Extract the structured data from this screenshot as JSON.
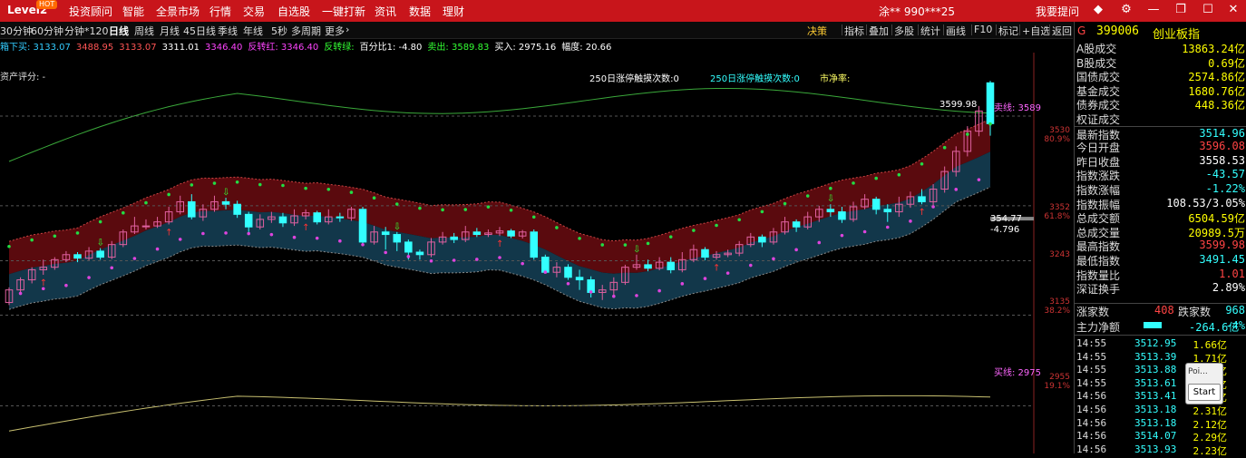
{
  "topbar": {
    "brand": "Level2",
    "hot_badge": "HOT",
    "menu": [
      "投资顾问",
      "智能",
      "全景市场",
      "行情",
      "交易",
      "自选股",
      "一键打新",
      "资讯",
      "数据",
      "理财"
    ],
    "user": "涂**  990***25",
    "help": "我要提问"
  },
  "periods": [
    "30分钟",
    "60分钟",
    "分钟*120",
    "日线",
    "周线",
    "月线",
    "45日线",
    "季线",
    "年线",
    "5秒",
    "多周期",
    "更多"
  ],
  "active_period": "日线",
  "tools": [
    "决策",
    "指标",
    "叠加",
    "多股",
    "统计",
    "画线",
    "F10",
    "标记",
    "+自选",
    "返回"
  ],
  "legend": [
    {
      "text": "箱下买: 3133.07",
      "color": "#33ccff"
    },
    {
      "text": "3488.95",
      "color": "#ff5555"
    },
    {
      "text": "3133.07",
      "color": "#ff5555"
    },
    {
      "text": "3311.01",
      "color": "#ffffff"
    },
    {
      "text": "3346.40",
      "color": "#ff44ff"
    },
    {
      "text": "反转红: 3346.40",
      "color": "#ff44ff"
    },
    {
      "text": "反转绿:",
      "color": "#33ff33"
    },
    {
      "text": "百分比1: -4.80",
      "color": "#ffffff"
    },
    {
      "text": "卖出: 3589.83",
      "color": "#33ff33"
    },
    {
      "text": "买入: 2975.16",
      "color": "#ffffff"
    },
    {
      "text": "幅度: 20.66",
      "color": "#ffffff"
    }
  ],
  "chart_labels": {
    "asset_score": "资产评分: -",
    "limit_up_touch": "250日涨停触摸次数:0",
    "limit_down_touch": "250日涨停触摸次数:0",
    "pb": "市净率:",
    "sell_line": "卖线: 3589",
    "buy_line": "买线: 2975",
    "high_mark": "3599.98",
    "cur_value": "354.77",
    "cur_change": "-4.796"
  },
  "price_axis": [
    {
      "price": "3530",
      "pct": "80.9%"
    },
    {
      "price": "3352",
      "pct": "61.8%"
    },
    {
      "price": "3243",
      "pct": ""
    },
    {
      "price": "3135",
      "pct": "38.2%"
    },
    {
      "price": "2955",
      "pct": "19.1%"
    }
  ],
  "quote_panel": {
    "code_prefix": "G",
    "code": "399006",
    "name": "创业板指",
    "rows": [
      {
        "label": "A股成交",
        "value": "13863.24亿",
        "color": "#ffff00"
      },
      {
        "label": "B股成交",
        "value": "0.69亿",
        "color": "#ffff00"
      },
      {
        "label": "国债成交",
        "value": "2574.86亿",
        "color": "#ffff00"
      },
      {
        "label": "基金成交",
        "value": "1680.76亿",
        "color": "#ffff00"
      },
      {
        "label": "债券成交",
        "value": "448.36亿",
        "color": "#ffff00"
      },
      {
        "label": "权证成交",
        "value": "",
        "color": "#ffff00"
      },
      {
        "label": "最新指数",
        "value": "3514.96",
        "color": "#33ffff"
      },
      {
        "label": "今日开盘",
        "value": "3596.08",
        "color": "#ff4444"
      },
      {
        "label": "昨日收盘",
        "value": "3558.53",
        "color": "#ffffff"
      },
      {
        "label": "指数涨跌",
        "value": "-43.57",
        "color": "#33ffff"
      },
      {
        "label": "指数涨幅",
        "value": "-1.22%",
        "color": "#33ffff"
      },
      {
        "label": "指数振幅",
        "value": "108.53/3.05%",
        "color": "#ffffff"
      },
      {
        "label": "总成交额",
        "value": "6504.59亿",
        "color": "#ffff00"
      },
      {
        "label": "总成交量",
        "value": "20989.5万",
        "color": "#ffff00"
      },
      {
        "label": "最高指数",
        "value": "3599.98",
        "color": "#ff4444"
      },
      {
        "label": "最低指数",
        "value": "3491.45",
        "color": "#33ffff"
      },
      {
        "label": "指数量比",
        "value": "1.01",
        "color": "#ff4444"
      },
      {
        "label": "深证换手",
        "value": "2.89%",
        "color": "#ffffff"
      }
    ],
    "up_label": "涨家数",
    "up_value": "408",
    "down_label": "跌家数",
    "down_value": "968",
    "netflow_label": "主力净额",
    "netflow_value": "-264.6亿",
    "netflow_pct": "-4%"
  },
  "ticks": [
    {
      "time": "14:55",
      "price": "3512.95",
      "vol": "1.66亿"
    },
    {
      "time": "14:55",
      "price": "3513.39",
      "vol": "1.71亿"
    },
    {
      "time": "14:55",
      "price": "3513.88",
      "vol": "1.89亿"
    },
    {
      "time": "14:55",
      "price": "3513.61",
      "vol": "1.69亿"
    },
    {
      "time": "14:56",
      "price": "3513.41",
      "vol": "1.59亿"
    },
    {
      "time": "14:56",
      "price": "3513.18",
      "vol": "2.31亿"
    },
    {
      "time": "14:56",
      "price": "3513.18",
      "vol": "2.12亿"
    },
    {
      "time": "14:56",
      "price": "3514.07",
      "vol": "2.29亿"
    },
    {
      "time": "14:56",
      "price": "3513.93",
      "vol": "2.23亿"
    }
  ],
  "popup": {
    "title": "Poi...",
    "button": "Start"
  },
  "chart_data": {
    "type": "candlestick",
    "ylabel": "",
    "ylim": [
      2900,
      3620
    ],
    "candles": [
      {
        "o": 3160,
        "c": 3185,
        "h": 3190,
        "l": 3155
      },
      {
        "o": 3185,
        "c": 3205,
        "h": 3210,
        "l": 3180
      },
      {
        "o": 3205,
        "c": 3225,
        "h": 3230,
        "l": 3198
      },
      {
        "o": 3225,
        "c": 3230,
        "h": 3245,
        "l": 3215
      },
      {
        "o": 3230,
        "c": 3245,
        "h": 3250,
        "l": 3225
      },
      {
        "o": 3245,
        "c": 3255,
        "h": 3262,
        "l": 3240
      },
      {
        "o": 3255,
        "c": 3248,
        "h": 3260,
        "l": 3240
      },
      {
        "o": 3248,
        "c": 3262,
        "h": 3270,
        "l": 3244
      },
      {
        "o": 3262,
        "c": 3250,
        "h": 3268,
        "l": 3245
      },
      {
        "o": 3250,
        "c": 3275,
        "h": 3282,
        "l": 3246
      },
      {
        "o": 3275,
        "c": 3300,
        "h": 3305,
        "l": 3270
      },
      {
        "o": 3300,
        "c": 3312,
        "h": 3330,
        "l": 3296
      },
      {
        "o": 3312,
        "c": 3312,
        "h": 3325,
        "l": 3305
      },
      {
        "o": 3312,
        "c": 3320,
        "h": 3330,
        "l": 3308
      },
      {
        "o": 3320,
        "c": 3340,
        "h": 3350,
        "l": 3315
      },
      {
        "o": 3340,
        "c": 3360,
        "h": 3372,
        "l": 3335
      },
      {
        "o": 3360,
        "c": 3330,
        "h": 3375,
        "l": 3325
      },
      {
        "o": 3330,
        "c": 3345,
        "h": 3355,
        "l": 3322
      },
      {
        "o": 3345,
        "c": 3360,
        "h": 3372,
        "l": 3340
      },
      {
        "o": 3360,
        "c": 3355,
        "h": 3368,
        "l": 3345
      },
      {
        "o": 3355,
        "c": 3335,
        "h": 3362,
        "l": 3328
      },
      {
        "o": 3335,
        "c": 3310,
        "h": 3340,
        "l": 3300
      },
      {
        "o": 3310,
        "c": 3325,
        "h": 3335,
        "l": 3305
      },
      {
        "o": 3325,
        "c": 3330,
        "h": 3340,
        "l": 3318
      },
      {
        "o": 3330,
        "c": 3318,
        "h": 3338,
        "l": 3310
      },
      {
        "o": 3318,
        "c": 3332,
        "h": 3345,
        "l": 3312
      },
      {
        "o": 3332,
        "c": 3338,
        "h": 3345,
        "l": 3325
      },
      {
        "o": 3338,
        "c": 3320,
        "h": 3342,
        "l": 3315
      },
      {
        "o": 3320,
        "c": 3330,
        "h": 3345,
        "l": 3315
      },
      {
        "o": 3330,
        "c": 3328,
        "h": 3338,
        "l": 3320
      },
      {
        "o": 3328,
        "c": 3345,
        "h": 3350,
        "l": 3322
      },
      {
        "o": 3345,
        "c": 3280,
        "h": 3350,
        "l": 3275
      },
      {
        "o": 3280,
        "c": 3300,
        "h": 3312,
        "l": 3275
      },
      {
        "o": 3300,
        "c": 3295,
        "h": 3310,
        "l": 3265
      },
      {
        "o": 3295,
        "c": 3280,
        "h": 3300,
        "l": 3262
      },
      {
        "o": 3280,
        "c": 3260,
        "h": 3285,
        "l": 3245
      },
      {
        "o": 3260,
        "c": 3255,
        "h": 3265,
        "l": 3245
      },
      {
        "o": 3255,
        "c": 3280,
        "h": 3288,
        "l": 3250
      },
      {
        "o": 3280,
        "c": 3290,
        "h": 3300,
        "l": 3275
      },
      {
        "o": 3290,
        "c": 3285,
        "h": 3298,
        "l": 3278
      },
      {
        "o": 3285,
        "c": 3300,
        "h": 3312,
        "l": 3280
      },
      {
        "o": 3300,
        "c": 3295,
        "h": 3308,
        "l": 3290
      },
      {
        "o": 3295,
        "c": 3298,
        "h": 3305,
        "l": 3290
      },
      {
        "o": 3298,
        "c": 3302,
        "h": 3310,
        "l": 3292
      },
      {
        "o": 3302,
        "c": 3292,
        "h": 3306,
        "l": 3288
      },
      {
        "o": 3292,
        "c": 3300,
        "h": 3304,
        "l": 3287
      },
      {
        "o": 3300,
        "c": 3250,
        "h": 3305,
        "l": 3245
      },
      {
        "o": 3250,
        "c": 3220,
        "h": 3255,
        "l": 3218
      },
      {
        "o": 3220,
        "c": 3230,
        "h": 3240,
        "l": 3210
      },
      {
        "o": 3230,
        "c": 3210,
        "h": 3236,
        "l": 3205
      },
      {
        "o": 3210,
        "c": 3205,
        "h": 3225,
        "l": 3185
      },
      {
        "o": 3205,
        "c": 3180,
        "h": 3212,
        "l": 3170
      },
      {
        "o": 3180,
        "c": 3185,
        "h": 3195,
        "l": 3165
      },
      {
        "o": 3185,
        "c": 3200,
        "h": 3210,
        "l": 3175
      },
      {
        "o": 3200,
        "c": 3230,
        "h": 3235,
        "l": 3195
      },
      {
        "o": 3230,
        "c": 3235,
        "h": 3255,
        "l": 3225
      },
      {
        "o": 3235,
        "c": 3228,
        "h": 3245,
        "l": 3222
      },
      {
        "o": 3228,
        "c": 3240,
        "h": 3250,
        "l": 3224
      },
      {
        "o": 3240,
        "c": 3225,
        "h": 3250,
        "l": 3218
      },
      {
        "o": 3225,
        "c": 3245,
        "h": 3260,
        "l": 3220
      },
      {
        "o": 3245,
        "c": 3265,
        "h": 3275,
        "l": 3240
      },
      {
        "o": 3265,
        "c": 3250,
        "h": 3270,
        "l": 3244
      },
      {
        "o": 3250,
        "c": 3255,
        "h": 3262,
        "l": 3245
      },
      {
        "o": 3255,
        "c": 3258,
        "h": 3265,
        "l": 3250
      },
      {
        "o": 3258,
        "c": 3275,
        "h": 3282,
        "l": 3252
      },
      {
        "o": 3275,
        "c": 3290,
        "h": 3298,
        "l": 3270
      },
      {
        "o": 3290,
        "c": 3280,
        "h": 3295,
        "l": 3270
      },
      {
        "o": 3280,
        "c": 3300,
        "h": 3308,
        "l": 3275
      },
      {
        "o": 3300,
        "c": 3320,
        "h": 3330,
        "l": 3295
      },
      {
        "o": 3320,
        "c": 3310,
        "h": 3325,
        "l": 3300
      },
      {
        "o": 3310,
        "c": 3330,
        "h": 3340,
        "l": 3305
      },
      {
        "o": 3330,
        "c": 3345,
        "h": 3352,
        "l": 3320
      },
      {
        "o": 3345,
        "c": 3340,
        "h": 3355,
        "l": 3330
      },
      {
        "o": 3340,
        "c": 3325,
        "h": 3350,
        "l": 3318
      },
      {
        "o": 3325,
        "c": 3350,
        "h": 3360,
        "l": 3320
      },
      {
        "o": 3350,
        "c": 3365,
        "h": 3375,
        "l": 3345
      },
      {
        "o": 3365,
        "c": 3345,
        "h": 3370,
        "l": 3335
      },
      {
        "o": 3345,
        "c": 3340,
        "h": 3355,
        "l": 3320
      },
      {
        "o": 3340,
        "c": 3355,
        "h": 3370,
        "l": 3330
      },
      {
        "o": 3355,
        "c": 3370,
        "h": 3380,
        "l": 3348
      },
      {
        "o": 3370,
        "c": 3360,
        "h": 3385,
        "l": 3355
      },
      {
        "o": 3360,
        "c": 3385,
        "h": 3395,
        "l": 3352
      },
      {
        "o": 3385,
        "c": 3420,
        "h": 3430,
        "l": 3378
      },
      {
        "o": 3420,
        "c": 3460,
        "h": 3470,
        "l": 3410
      },
      {
        "o": 3460,
        "c": 3500,
        "h": 3510,
        "l": 3450
      },
      {
        "o": 3500,
        "c": 3540,
        "h": 3550,
        "l": 3490
      },
      {
        "o": 3596,
        "c": 3515,
        "h": 3600,
        "l": 3491
      }
    ]
  }
}
